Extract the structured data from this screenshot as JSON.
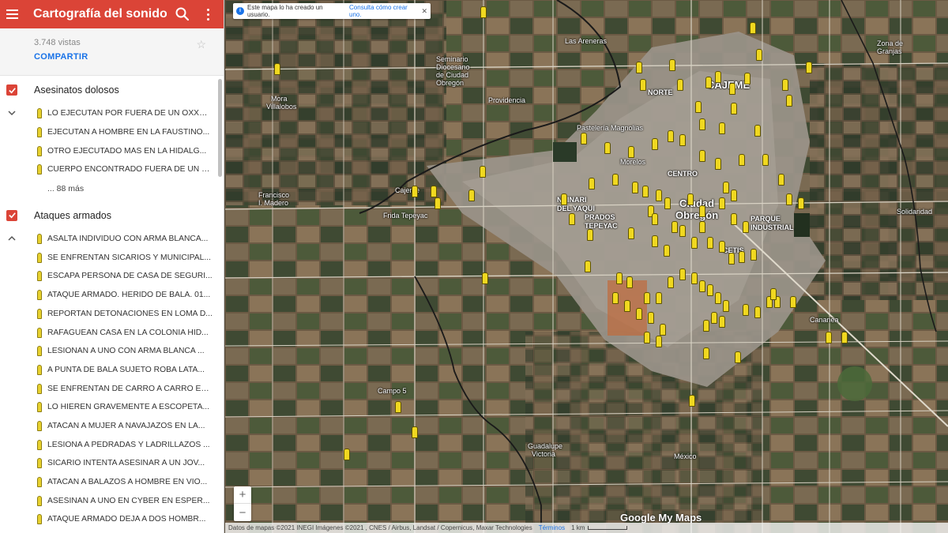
{
  "app": {
    "title": "Cartografía del sonido ...",
    "views": "3.748 vistas",
    "share_label": "COMPARTIR"
  },
  "layers": [
    {
      "name": "Asesinatos dolosos",
      "items": [
        "LO EJECUTAN POR FUERA DE UN OXXO ...",
        "EJECUTAN A HOMBRE EN LA FAUSTINO...",
        "OTRO EJECUTADO MÁS EN LA HIDALG...",
        "CUERPO ENCONTRADO FUERA DE UN O..."
      ],
      "more_label": "... 88 más"
    },
    {
      "name": "Ataques armados",
      "items": [
        "ASALTA INDIVIDUO CON ARMA BLANCA...",
        "SE ENFRENTAN SICARIOS Y MUNICIPAL...",
        "ESCAPA PERSONA DE CASA DE SEGURI...",
        "ATAQUE ARMADO. HERIDO DE BALA. 01...",
        "REPORTAN DETONACIONES EN LOMA D...",
        "RAFAGUEAN CASA EN LA COLONIA HID...",
        "LESIONAN A UNO CON ARMA BLANCA ...",
        "A PUNTA DE BALA SUJETO ROBA LATA...",
        "SE ENFRENTAN DE CARRO A CARRO EN...",
        "LO HIEREN GRAVEMENTE A ESCOPETA...",
        "ATACAN A MUJER A NAVAJAZOS EN LA...",
        "LESIONA A PEDRADAS Y LADRILLAZOS ...",
        "SICARIO INTENTA ASESINAR A UN JOV...",
        "ATACAN A BALAZOS A HOMBRE EN VIO...",
        "ASESINAN A UNO EN CYBER EN ESPER...",
        "ATAQUE ARMADO DEJA A DOS HOMBR..."
      ]
    }
  ],
  "map": {
    "notice_text": "Este mapa lo ha creado un usuario.",
    "notice_link": "Consulta cómo crear uno.",
    "zoom_in": "+",
    "zoom_out": "−",
    "footer_attribution": "Datos de mapas ©2021 INEGI Imágenes ©2021 , CNES / Airbus, Landsat / Copernicus, Maxar Technologies",
    "footer_terms": "Términos",
    "footer_scale": "1 km",
    "logo": "Google My Maps",
    "places": {
      "ciudad_obregon_1": "Ciudad",
      "ciudad_obregon_2": "Obregón",
      "cajeme": "CAJEME",
      "norte": "NORTE",
      "centro": "CENTRO",
      "nainari": "NAINARI",
      "del_yaqui": "DEL YAQUI",
      "prados": "PRADOS",
      "tepeyac": "TEPEYAC",
      "parque": "PARQUE",
      "industrial": "INDUSTRIAL",
      "las_areneras": "Las Areneras",
      "providencia": "Providencia",
      "seminario": "Seminario",
      "diocesano": "Diocesano",
      "de_ciudad": "de Ciudad",
      "obregon_s": "Obregón",
      "pasteleria": "Pastelería Magnolias",
      "mora": "Mora",
      "villalobos": "Villalobos",
      "francisco": "Francisco",
      "i_madero": "I. Madero",
      "cajeme_town": "Cajeme",
      "frida": "Frida Tepeyac",
      "campo5": "Campo 5",
      "guadalupe": "Guadalupe",
      "victoria": "Victoria",
      "mexico": "México",
      "zona_granjas_1": "Zona de",
      "zona_granjas_2": "Granjas",
      "solidaridad": "Solidaridad",
      "cetis": "CETIS",
      "morelos": "Morelos",
      "cananea": "Cananea"
    }
  }
}
